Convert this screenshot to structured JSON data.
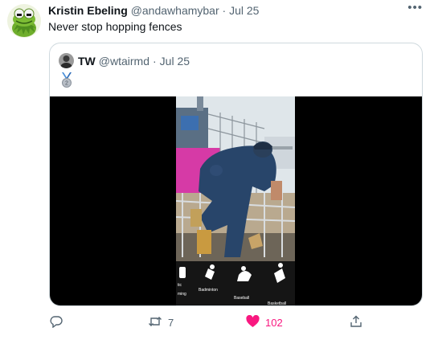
{
  "tweet": {
    "author_name": "Kristin Ebeling",
    "author_handle": "@andawhamybar",
    "separator": "·",
    "date": "Jul 25",
    "text": "Never stop hopping fences",
    "more_label": "•••"
  },
  "quoted_tweet": {
    "author_name": "TW",
    "author_handle": "@wtairmd",
    "separator": "·",
    "date": "Jul 25",
    "medal_icon": "silver-medal-icon",
    "medal_number": "2",
    "video_captions": [
      "tic",
      "ming",
      "Badminton",
      "Baseball",
      "Basketball"
    ]
  },
  "actions": {
    "reply_icon": "reply-icon",
    "retweet_icon": "retweet-icon",
    "retweet_count": "7",
    "like_icon": "heart-icon",
    "like_count": "102",
    "share_icon": "share-icon"
  },
  "colors": {
    "like": "#f91880",
    "muted": "#536471",
    "border": "#cfd9de",
    "pink_banner": "#d63aa6"
  }
}
